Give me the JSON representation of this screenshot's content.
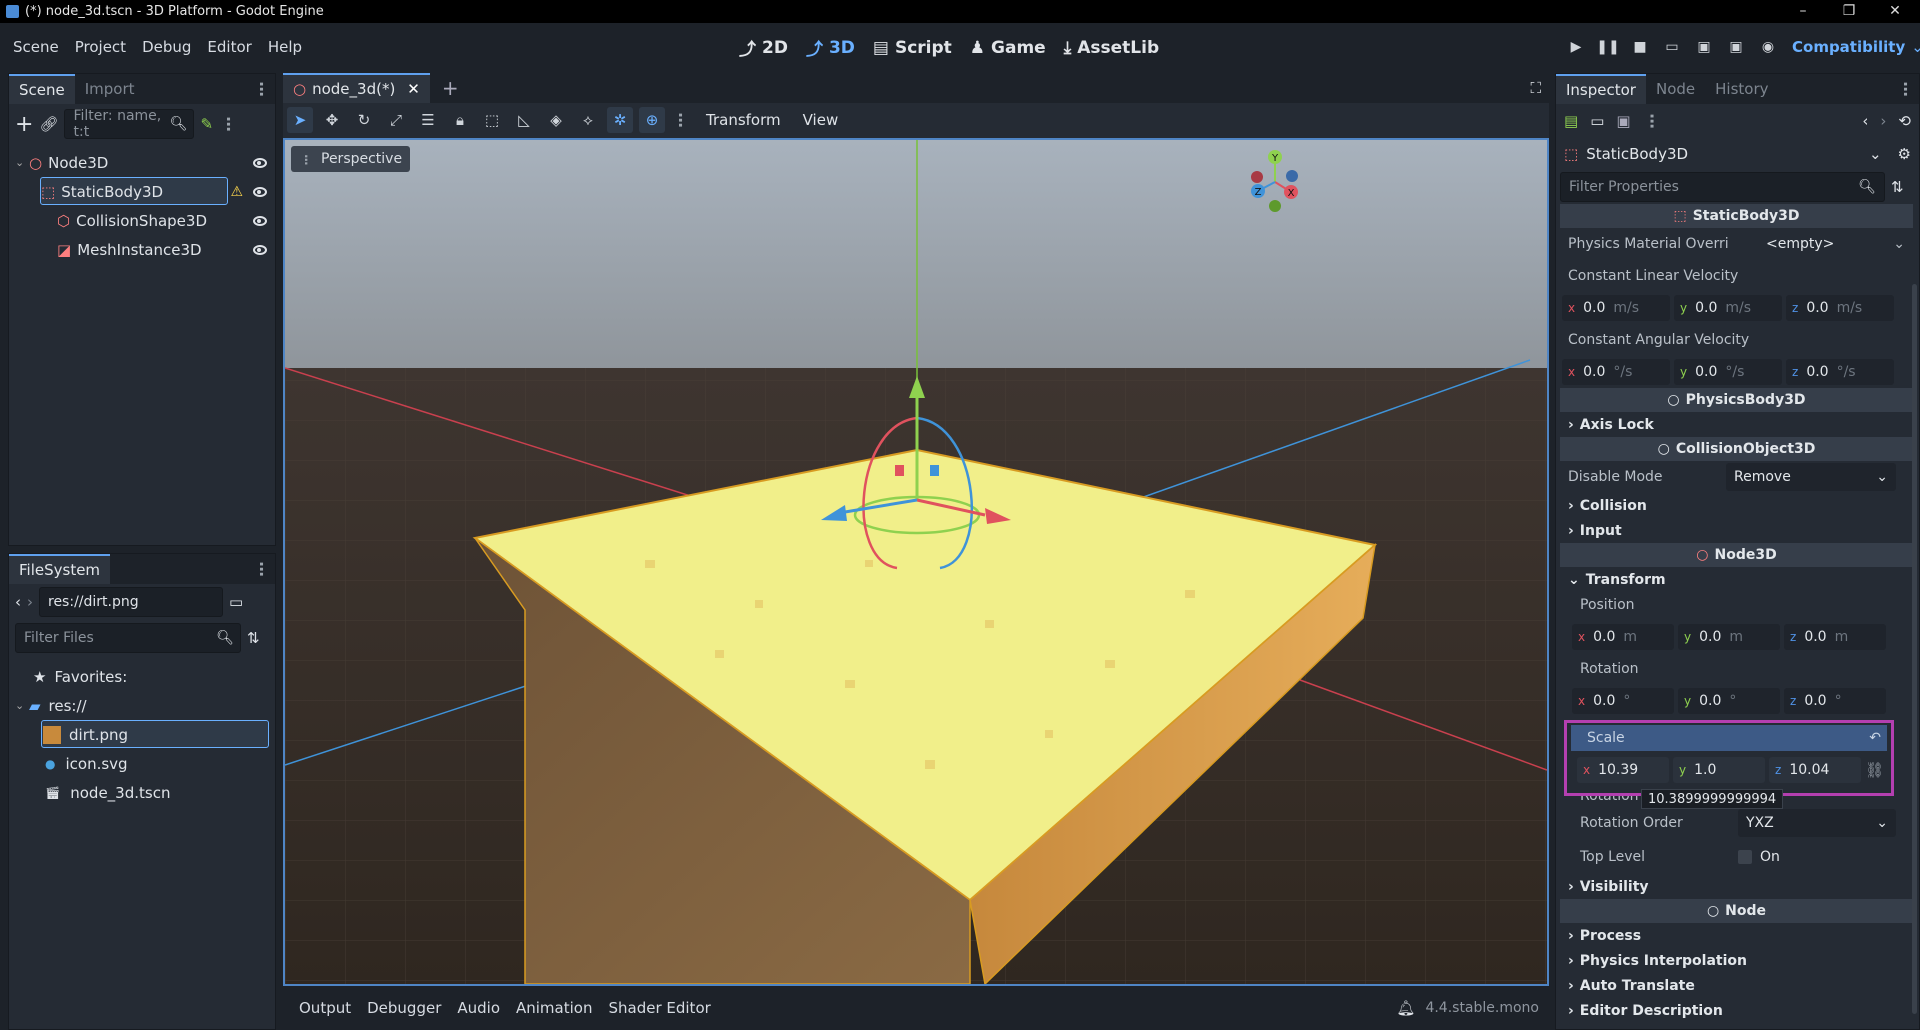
{
  "window": {
    "title": "(*) node_3d.tscn - 3D Platform - Godot Engine"
  },
  "menu": [
    "Scene",
    "Project",
    "Debug",
    "Editor",
    "Help"
  ],
  "workspaces": [
    {
      "label": "2D",
      "icon": "2d-icon"
    },
    {
      "label": "3D",
      "icon": "3d-icon"
    },
    {
      "label": "Script",
      "icon": "script-icon"
    },
    {
      "label": "Game",
      "icon": "game-icon"
    },
    {
      "label": "AssetLib",
      "icon": "assetlib-icon"
    }
  ],
  "renderer": "Compatibility",
  "scene_dock": {
    "tabs": [
      "Scene",
      "Import"
    ],
    "filter_placeholder": "Filter: name, t:t",
    "nodes": [
      "Node3D",
      "StaticBody3D",
      "CollisionShape3D",
      "MeshInstance3D"
    ]
  },
  "filesystem": {
    "tab": "FileSystem",
    "path": "res://dirt.png",
    "filter_placeholder": "Filter Files",
    "favorites": "Favorites:",
    "root": "res://",
    "files": [
      "dirt.png",
      "icon.svg",
      "node_3d.tscn"
    ]
  },
  "editor": {
    "tab_label": "node_3d(*)",
    "toolbar_menus": [
      "Transform",
      "View"
    ],
    "perspective": "Perspective",
    "gizmo_labels": {
      "y": "Y",
      "x": "X",
      "z": "Z"
    }
  },
  "bottom": {
    "tabs": [
      "Output",
      "Debugger",
      "Audio",
      "Animation",
      "Shader Editor"
    ],
    "version": "4.4.stable.mono"
  },
  "inspector": {
    "tabs": [
      "Inspector",
      "Node",
      "History"
    ],
    "node_selector": "StaticBody3D",
    "filter_placeholder": "Filter Properties",
    "static_body_header": "StaticBody3D",
    "physics_material_label": "Physics Material Overri",
    "physics_material_value": "<empty>",
    "const_linear_label": "Constant Linear Velocity",
    "const_linear": {
      "x": "0.0",
      "y": "0.0",
      "z": "0.0",
      "unit": "m/s"
    },
    "const_angular_label": "Constant Angular Velocity",
    "const_angular": {
      "x": "0.0",
      "y": "0.0",
      "z": "0.0",
      "unit": "°/s"
    },
    "physics_body_header": "PhysicsBody3D",
    "axis_lock": "Axis Lock",
    "collision_object_header": "CollisionObject3D",
    "disable_mode_label": "Disable Mode",
    "disable_mode_value": "Remove",
    "collision": "Collision",
    "input": "Input",
    "node3d_header": "Node3D",
    "transform": "Transform",
    "position_label": "Position",
    "position": {
      "x": "0.0",
      "y": "0.0",
      "z": "0.0",
      "unit": "m"
    },
    "rotation_label": "Rotation",
    "rotation": {
      "x": "0.0",
      "y": "0.0",
      "z": "0.0",
      "unit": "°"
    },
    "scale_label": "Scale",
    "scale": {
      "x": "10.39",
      "y": "1.0",
      "z": "10.04"
    },
    "tooltip": "10.3899999999994",
    "rotation_edit_label": "Rotation",
    "rotation_order_label": "Rotation Order",
    "rotation_order_value": "YXZ",
    "top_level_label": "Top Level",
    "top_level_value": "On",
    "visibility": "Visibility",
    "node_header": "Node",
    "process": "Process",
    "physics_interp": "Physics Interpolation",
    "auto_translate": "Auto Translate",
    "editor_description": "Editor Description"
  }
}
